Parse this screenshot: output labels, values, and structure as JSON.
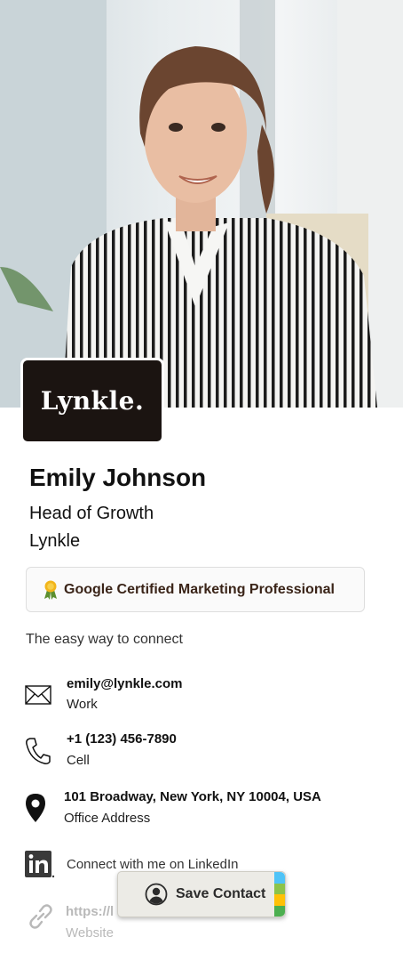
{
  "card": {
    "logo_text": "Lynkle.",
    "name": "Emily Johnson",
    "title": "Head of Growth",
    "company": "Lynkle",
    "badge": "Google Certified Marketing Professional",
    "tagline": "The easy way to connect"
  },
  "contacts": [
    {
      "icon": "envelope-icon",
      "primary": "emily@lynkle.com",
      "secondary": "Work"
    },
    {
      "icon": "phone-icon",
      "primary": "+1 (123) 456-7890",
      "secondary": "Cell"
    },
    {
      "icon": "location-pin-icon",
      "primary": "101 Broadway, New York, NY 10004, USA",
      "secondary": "Office Address"
    },
    {
      "icon": "linkedin-icon",
      "primary": "",
      "secondary": "Connect with me on LinkedIn"
    },
    {
      "icon": "link-icon",
      "primary": "https://l",
      "secondary": "Website"
    }
  ],
  "save_button": {
    "label": "Save Contact",
    "icon": "user-circle-icon",
    "strip_colors": [
      "#4fc3f7",
      "#8bc34a",
      "#ffc107",
      "#4caf50"
    ]
  },
  "colors": {
    "logo_bg": "#1b1411",
    "badge_text": "#3a2418",
    "save_bg": "#ecebe6"
  }
}
